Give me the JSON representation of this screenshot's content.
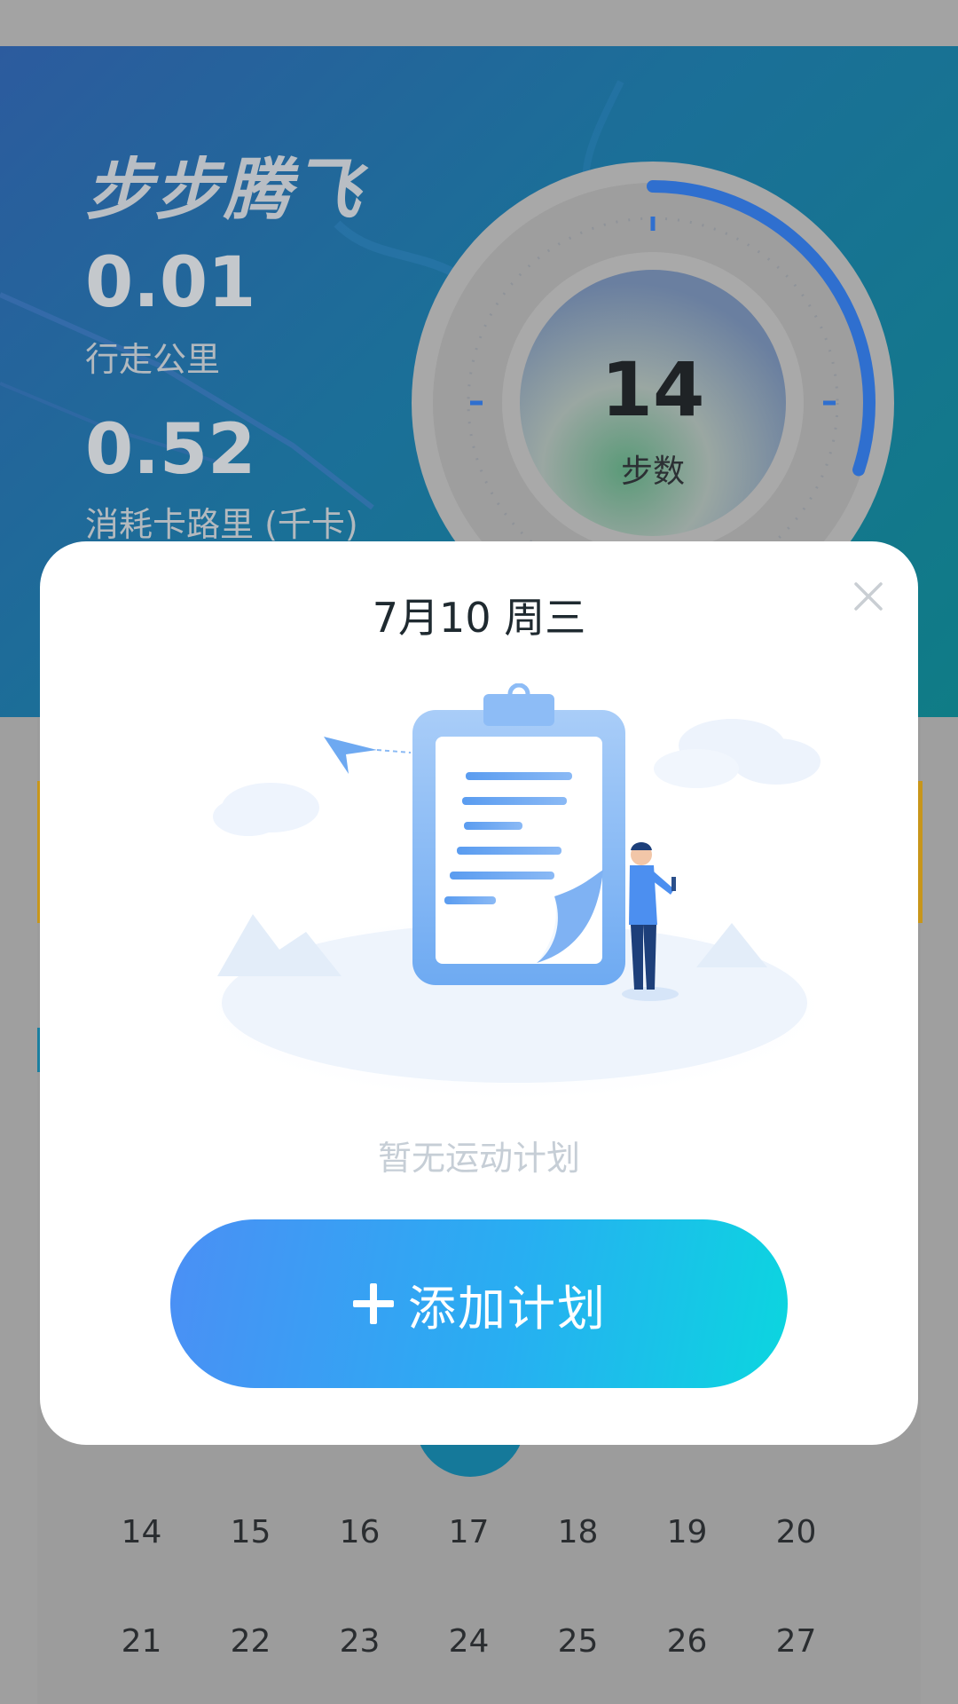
{
  "hero": {
    "app_title": "步步腾飞",
    "distance_value": "0.01",
    "distance_label": "行走公里",
    "calories_value": "0.52",
    "calories_label": "消耗卡路里 (千卡)",
    "steps_value": "14",
    "steps_label": "步数",
    "steps_progress_fraction": 0.3
  },
  "calendar": {
    "rows": [
      [
        "14",
        "15",
        "16",
        "17",
        "18",
        "19",
        "20"
      ],
      [
        "21",
        "22",
        "23",
        "24",
        "25",
        "26",
        "27"
      ]
    ]
  },
  "modal": {
    "title": "7月10  周三",
    "empty_text": "暂无运动计划",
    "add_button_label": "添加计划",
    "close_icon": "close-icon",
    "plus_icon": "plus-icon"
  },
  "colors": {
    "button_gradient_start": "#4b8ff5",
    "button_gradient_end": "#0bd6df",
    "ring_progress": "#2f6fcf",
    "calendar_selected": "#15799a"
  }
}
